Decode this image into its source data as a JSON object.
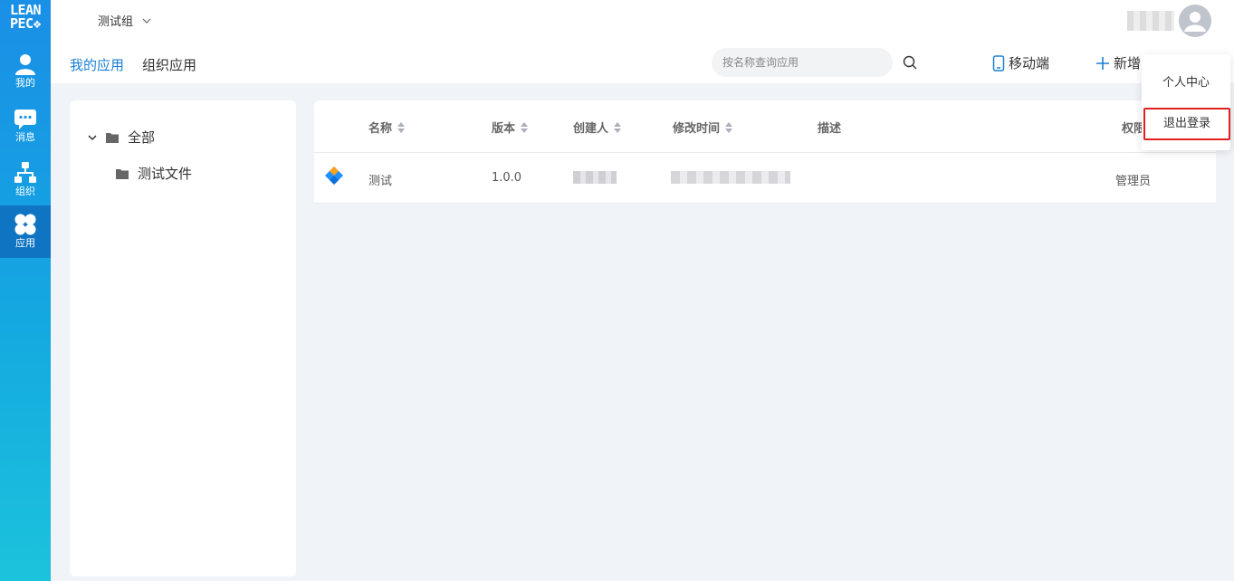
{
  "sidebar": {
    "logo_line1": "LEAN",
    "logo_line2": "PEC",
    "items": [
      {
        "label": "我的",
        "icon": "user-icon"
      },
      {
        "label": "消息",
        "icon": "message-icon"
      },
      {
        "label": "组织",
        "icon": "org-icon"
      },
      {
        "label": "应用",
        "icon": "apps-icon"
      }
    ],
    "active_index": 3
  },
  "header": {
    "group_name": "测试组",
    "tabs": [
      {
        "label": "我的应用",
        "active": true
      },
      {
        "label": "组织应用",
        "active": false
      }
    ],
    "search_placeholder": "按名称查询应用",
    "mobile_label": "移动端",
    "add_label": "新增"
  },
  "user_menu": {
    "items": [
      {
        "label": "个人中心"
      },
      {
        "label": "退出登录"
      }
    ]
  },
  "folders": {
    "root_label": "全部",
    "children": [
      {
        "label": "测试文件"
      }
    ]
  },
  "table": {
    "columns": [
      "名称",
      "版本",
      "创建人",
      "修改时间",
      "描述",
      "权限"
    ],
    "rows": [
      {
        "name": "测试",
        "version": "1.0.0",
        "creator": "",
        "modified": "",
        "description": "",
        "permission": "管理员"
      }
    ]
  },
  "colors": {
    "accent": "#1a7fd6",
    "sidebar_top": "#1a8fe6",
    "sidebar_bottom": "#1cc3dc",
    "highlight_border": "#e02020"
  }
}
